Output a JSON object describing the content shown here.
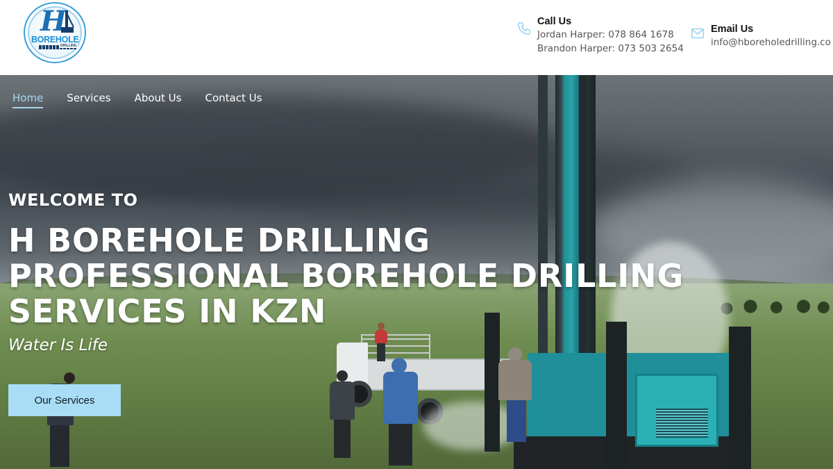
{
  "header": {
    "logo": {
      "text": "BOREHOLE",
      "sub": "DRILLING",
      "mark": "H"
    },
    "call": {
      "title": "Call Us",
      "lines": [
        "Jordan Harper: 078 864 1678",
        "Brandon Harper: 073 503 2654"
      ],
      "icon": "phone-icon"
    },
    "email": {
      "title": "Email Us",
      "address": "info@hboreholedrilling.co",
      "icon": "envelope-icon"
    }
  },
  "nav": {
    "items": [
      {
        "label": "Home",
        "active": true
      },
      {
        "label": "Services",
        "active": false
      },
      {
        "label": "About Us",
        "active": false
      },
      {
        "label": "Contact Us",
        "active": false
      }
    ]
  },
  "hero": {
    "welcome": "WELCOME TO",
    "headline": [
      "H BOREHOLE DRILLING",
      "PROFESSIONAL BOREHOLE DRILLING",
      "SERVICES IN KZN"
    ],
    "tagline": "Water Is Life",
    "cta_label": "Our Services"
  },
  "colors": {
    "accent": "#a9dcf5",
    "nav_active": "#a8d6f2",
    "brand_blue": "#1a8fd6"
  }
}
